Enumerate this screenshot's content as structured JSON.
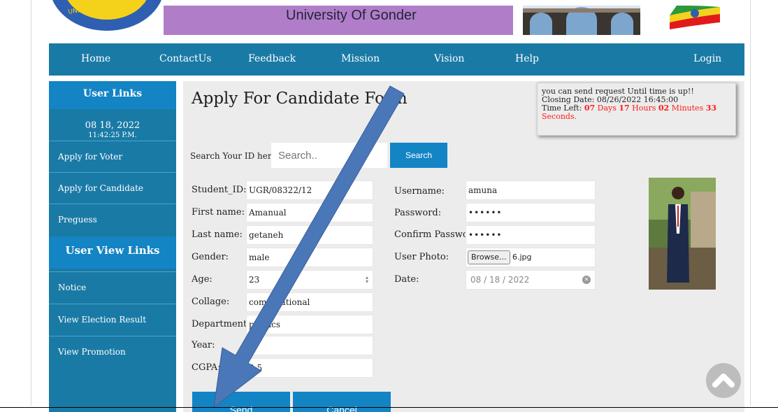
{
  "header": {
    "title": "University Of Gonder",
    "logo_text": "UNIVERSITY OF GONDAR"
  },
  "nav": {
    "items": [
      "Home",
      "ContactUs",
      "Feedback",
      "Mission",
      "Vision",
      "Help",
      "Login"
    ]
  },
  "sidebar": {
    "user_links_heading": "User Links",
    "date": "08 18, 2022",
    "time": "11:42:25 P.M.",
    "links": [
      "Apply for Voter",
      "Apply for Candidate",
      "Preguess"
    ],
    "user_view_heading": "User View Links",
    "view_links": [
      "Notice",
      "View Election Result",
      "View Promotion"
    ]
  },
  "main": {
    "title": "Apply For Candidate Form",
    "notice": {
      "line1": "you can send request Until time is up!!",
      "line2": "Closing Date: 08/26/2022 16:45:00",
      "time_left_label": "Time Left: ",
      "days_num": "07",
      "days_word": " Days ",
      "hours_num": "17",
      "hours_word": " Hours ",
      "minutes_num": "02",
      "minutes_word": " Minutes ",
      "seconds_num": "33",
      "seconds_word": "Seconds."
    },
    "search": {
      "label": "Search Your ID here",
      "placeholder": "Search..",
      "button": "Search"
    },
    "left_fields": [
      {
        "label": "Student_ID:",
        "value": "UGR/08322/12"
      },
      {
        "label": "First name:",
        "value": "Amanual"
      },
      {
        "label": "Last name:",
        "value": "getaneh"
      },
      {
        "label": "Gender:",
        "value": "male"
      },
      {
        "label": "Age:",
        "value": "23"
      },
      {
        "label": "Collage:",
        "value": "computational"
      },
      {
        "label": "Department:",
        "value": "physics"
      },
      {
        "label": "Year:",
        "value": ""
      },
      {
        "label": "CGPA:",
        "value": "3.5"
      }
    ],
    "right_fields": {
      "username_label": "Username:",
      "username_value": "amuna",
      "password_label": "Password:",
      "password_value": "••••••",
      "confirm_label": "Confirm Password:",
      "confirm_value": "••••••",
      "photo_label": "User Photo:",
      "browse_label": "Browse...",
      "file_name": "6.jpg",
      "date_label": "Date:",
      "date_value": "08 / 18 / 2022"
    },
    "buttons": {
      "send": "Send",
      "cancel": "Cancel"
    }
  },
  "colors": {
    "nav": "#1a7aa6",
    "accent": "#1384c4",
    "banner": "#b07ec8",
    "annotation_arrow": "#4a77b8"
  }
}
